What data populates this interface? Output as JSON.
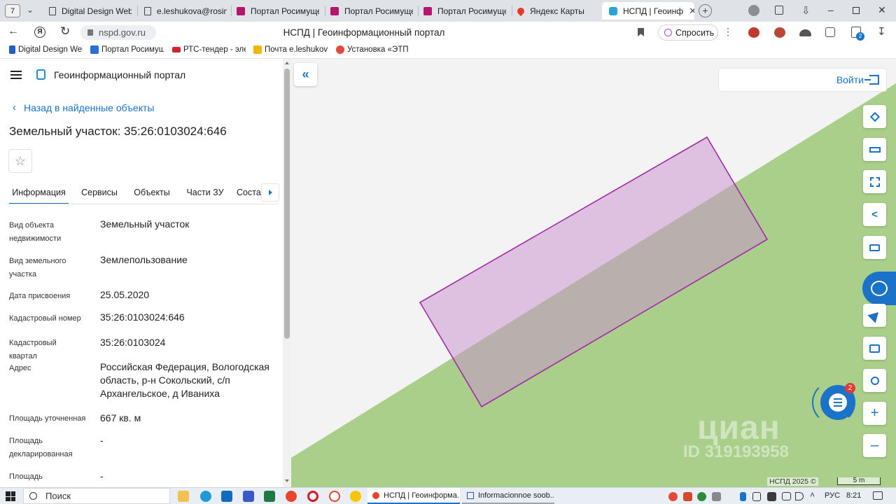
{
  "browser": {
    "tab_count": "7",
    "tabs": [
      {
        "label": "Digital Design Web",
        "color": "#2b6fd6"
      },
      {
        "label": "e.leshukova@rosim",
        "color": "#6b6b6b"
      },
      {
        "label": "Портал Росимуще",
        "color": "#b3166b"
      },
      {
        "label": "Портал Росимуще",
        "color": "#b3166b"
      },
      {
        "label": "Портал Росимуще",
        "color": "#b3166b"
      },
      {
        "label": "Яндекс Карты",
        "color": "#e8382c"
      },
      {
        "label": "НСПД | Геоинф",
        "color": "#29a3d8"
      }
    ],
    "url": "nspd.gov.ru",
    "page_title": "НСПД | Геоинформационный портал",
    "ask_label": "Спросить",
    "downloads_badge": "2",
    "bookmarks": [
      {
        "label": "Digital Design Web",
        "color": "#1f5fc7"
      },
      {
        "label": "Портал Росимущ",
        "color": "#2b6fd6"
      },
      {
        "label": "РТС-тендер - элек",
        "color": "#d3232f"
      },
      {
        "label": "Почта e.leshukova",
        "color": "#f2b705"
      },
      {
        "label": "Установка «ЭТП и",
        "color": "#e24a3b"
      }
    ]
  },
  "panel": {
    "app_title": "Геоинформационный портал",
    "back_link": "Назад в найденные объекты",
    "object_title": "Земельный участок: 35:26:0103024:646",
    "tabs": [
      "Информация",
      "Сервисы",
      "Объекты",
      "Части ЗУ",
      "Соста"
    ],
    "properties": [
      {
        "label": "Вид объекта недвижимости",
        "value": "Земельный участок"
      },
      {
        "label": "Вид земельного участка",
        "value": "Землепользование"
      },
      {
        "label": "Дата присвоения",
        "value": "25.05.2020"
      },
      {
        "label": "Кадастровый номер",
        "value": "35:26:0103024:646"
      },
      {
        "label": "Кадастровый квартал",
        "value": "35:26:0103024"
      },
      {
        "label": "Адрес",
        "value": "Российская Федерация, Вологодская область, р-н Сокольский, с/п Архангельское, д Иваниха"
      },
      {
        "label": "Площадь уточненная",
        "value": "667 кв. м"
      },
      {
        "label": "Площадь декларированная",
        "value": "-"
      },
      {
        "label": "Площадь",
        "value": "-"
      }
    ]
  },
  "map": {
    "login_label": "Войти",
    "chat_badge": "2",
    "watermark_brand": "циан",
    "watermark_id": "ID 319193958",
    "copyright": "НСПД 2025 ©",
    "scale_label": "5 m",
    "colors": {
      "accent": "#1a73c9",
      "parcel_fill": "#e4c4e6",
      "parcel_stroke": "#a22aa8",
      "field": "#a9cf8a"
    }
  },
  "taskbar": {
    "search_label": "Поиск",
    "apps": [
      {
        "label": "НСПД | Геоинформа..."
      },
      {
        "label": "Informacionnoe soob..."
      }
    ],
    "lang": "РУС",
    "time": "8:21"
  }
}
